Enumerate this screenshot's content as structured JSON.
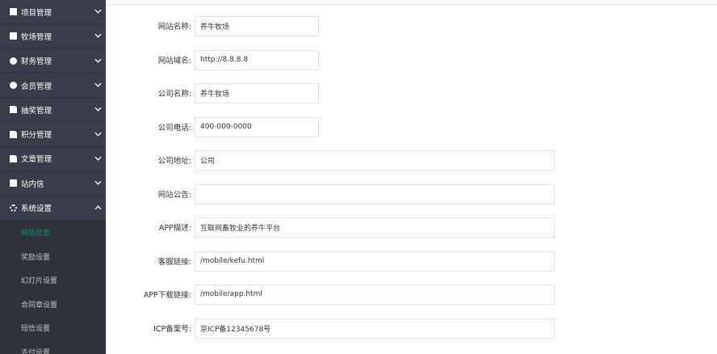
{
  "sidebar": {
    "menus": [
      {
        "label": "项目管理",
        "icon": "grid-icon"
      },
      {
        "label": "牧场管理",
        "icon": "grid-icon"
      },
      {
        "label": "财务管理",
        "icon": "yen-icon"
      },
      {
        "label": "会员管理",
        "icon": "vip-icon"
      },
      {
        "label": "抽奖管理",
        "icon": "document-icon"
      },
      {
        "label": "积分管理",
        "icon": "document-icon"
      },
      {
        "label": "文章管理",
        "icon": "document-icon"
      },
      {
        "label": "站内信",
        "icon": "grid-icon"
      },
      {
        "label": "系统设置",
        "icon": "gear-icon"
      }
    ],
    "submenu": [
      {
        "label": "网站信息",
        "active": true
      },
      {
        "label": "奖励设置"
      },
      {
        "label": "幻灯片设置"
      },
      {
        "label": "合同章设置"
      },
      {
        "label": "短信设置"
      },
      {
        "label": "支付设置"
      }
    ]
  },
  "form": {
    "site_name": {
      "label": "网站名称:",
      "value": "养牛牧场"
    },
    "site_domain": {
      "label": "网站域名:",
      "value": "http://8.8.8.8"
    },
    "company_name": {
      "label": "公司名称:",
      "value": "养牛牧场"
    },
    "company_phone": {
      "label": "公司电话:",
      "value": "400-000-0000"
    },
    "company_address": {
      "label": "公司地址:",
      "value": "公司"
    },
    "site_notice": {
      "label": "网站公告:",
      "value": ""
    },
    "app_desc": {
      "label": "APP描述:",
      "value": "互联网畜牧业的养牛平台"
    },
    "service_link": {
      "label": "客服链接:",
      "value": "/mobile/kefu.html"
    },
    "app_download": {
      "label": "APP下载链接:",
      "value": "/mobile/app.html"
    },
    "icp": {
      "label": "ICP备案号:",
      "value": "京ICP备12345678号"
    }
  }
}
